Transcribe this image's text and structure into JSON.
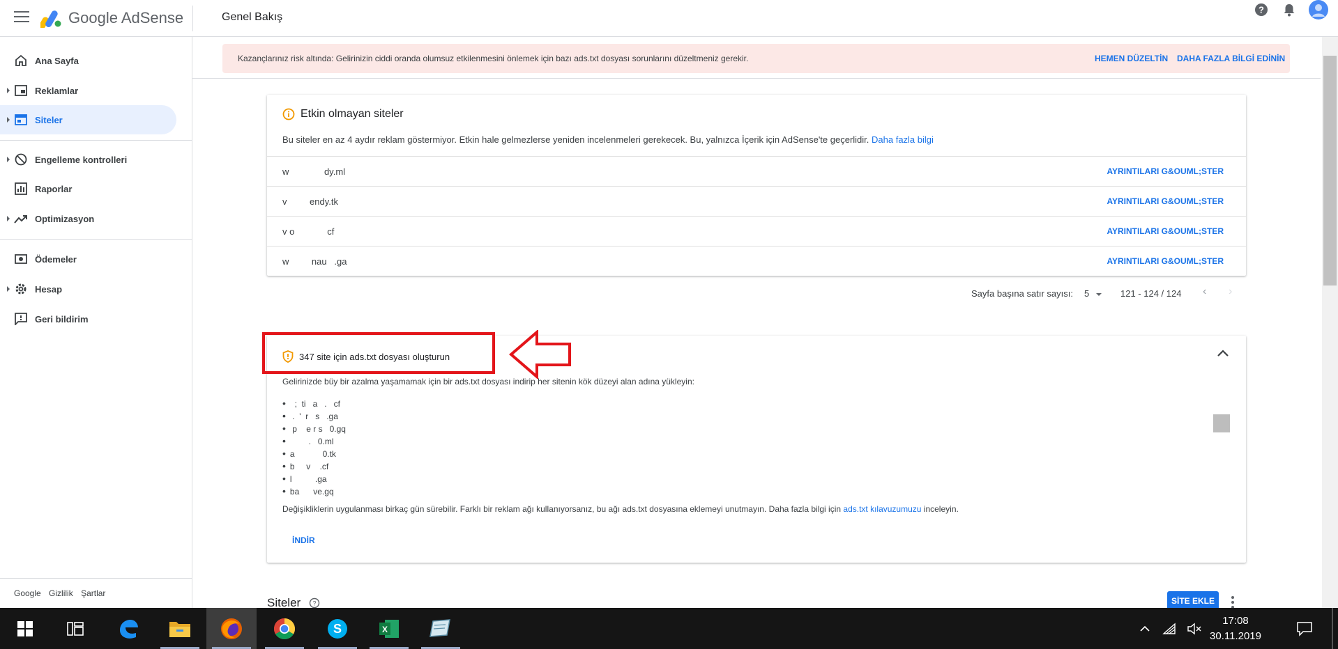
{
  "header": {
    "brand": "Google AdSense",
    "page_title": "Genel Bakış",
    "icons": [
      "help-icon",
      "notifications-icon",
      "account-avatar"
    ]
  },
  "sidebar": {
    "items": [
      {
        "label": "Ana Sayfa",
        "icon": "home-icon"
      },
      {
        "label": "Reklamlar",
        "icon": "ads-icon"
      },
      {
        "label": "Siteler",
        "icon": "sites-icon"
      },
      {
        "label": "Engelleme kontrolleri",
        "icon": "block-icon"
      },
      {
        "label": "Raporlar",
        "icon": "reports-icon"
      },
      {
        "label": "Optimizasyon",
        "icon": "optimization-icon"
      },
      {
        "label": "Ödemeler",
        "icon": "payments-icon"
      },
      {
        "label": "Hesap",
        "icon": "settings-icon"
      },
      {
        "label": "Geri bildirim",
        "icon": "feedback-icon"
      }
    ],
    "footer": [
      "Google",
      "Gizlilik",
      "Şartlar"
    ]
  },
  "alert": {
    "text": "Kazançlarınız risk altında: Gelirinizin ciddi oranda olumsuz etkilenmesini önlemek için bazı ads.txt dosyası sorunlarını düzeltmeniz gerekir.",
    "fix": "HEMEN DÜZELTİN",
    "learn": "DAHA FAZLA BİLGİ EDİNİN"
  },
  "inactive_sites": {
    "title": "Etkin olmayan siteler",
    "desc": "Bu siteler en az 4 aydır reklam göstermiyor. Etkin hale gelmezlerse yeniden incelenmeleri gerekecek. Bu, yalnızca İçerik için AdSense'te geçerlidir.",
    "desc_link": "Daha fazla bilgi",
    "rows": [
      {
        "name": "w              dy.ml",
        "action": "AYRINTILARI G&OUML;STER"
      },
      {
        "name": "v         endy.tk",
        "action": "AYRINTILARI G&OUML;STER"
      },
      {
        "name": "v o             cf",
        "action": "AYRINTILARI G&OUML;STER"
      },
      {
        "name": "w         nau   .ga",
        "action": "AYRINTILARI G&OUML;STER"
      }
    ]
  },
  "pager": {
    "rows_label": "Sayfa başına satır sayısı:",
    "rows_value": "5",
    "range": "121 - 124 / 124"
  },
  "ads_txt": {
    "title": "347 site için ads.txt dosyası oluşturun",
    "intro": "Gelirinizde büy   bir azalma yaşamamak için bir ads.txt dosyası indirip her sitenin kök düzeyi alan adına yükleyin:",
    "sites": [
      "  ;  ti   a   .   cf",
      " .  '  r   s   .ga",
      " p    e r s   0.gq",
      "        .   0.ml",
      "a            0.tk",
      "b     v    .cf",
      "l          .ga",
      "ba      ve.gq"
    ],
    "note": "Değişikliklerin uygulanması birkaç gün sürebilir. Farklı bir reklam ağı kullanıyorsanız, bu ağı ads.txt dosyasına eklemeyi unutmayın. Daha fazla bilgi için",
    "note_link": "ads.txt kılavuzumuzu",
    "note_end": "inceleyin.",
    "download": "İNDİR"
  },
  "sites_section": {
    "title": "Siteler",
    "add_button": "SİTE EKLE"
  },
  "taskbar": {
    "apps": [
      "start-icon",
      "task-view-icon",
      "edge-icon",
      "file-explorer-icon",
      "firefox-icon",
      "chrome-icon",
      "skype-icon",
      "excel-icon",
      "notes-app-icon"
    ],
    "time": "17:08",
    "date": "30.11.2019"
  },
  "colors": {
    "accent": "#1a73e8",
    "alert_bg": "#fce8e6",
    "warning": "#f29900",
    "annotation_red": "#e3151a"
  }
}
